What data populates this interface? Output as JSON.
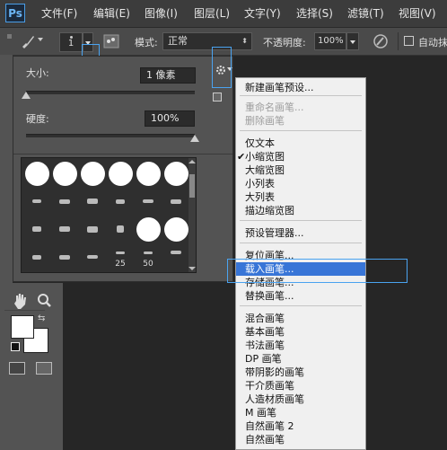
{
  "app": {
    "logo": "Ps"
  },
  "menubar": {
    "items": [
      "文件(F)",
      "编辑(E)",
      "图像(I)",
      "图层(L)",
      "文字(Y)",
      "选择(S)",
      "滤镜(T)",
      "视图(V)"
    ]
  },
  "options_bar": {
    "brush_size": "1",
    "mode_label": "模式:",
    "mode_value": "正常",
    "opacity_label": "不透明度:",
    "opacity_value": "100%",
    "auto_label": "自动抹"
  },
  "brush_panel": {
    "size_label": "大小:",
    "size_value": "1 像素",
    "size_slider": 0,
    "hardness_label": "硬度:",
    "hardness_value": "100%",
    "hardness_slider": 1,
    "preset_numbers": [
      "25",
      "50"
    ]
  },
  "context_menu": {
    "items": [
      {
        "label": "新建画笔预设...",
        "state": "normal"
      },
      {
        "label": "重命名画笔...",
        "state": "disabled"
      },
      {
        "label": "删除画笔",
        "state": "disabled"
      },
      {
        "label": "仅文本",
        "state": "normal"
      },
      {
        "label": "小缩览图",
        "state": "checked"
      },
      {
        "label": "大缩览图",
        "state": "normal"
      },
      {
        "label": "小列表",
        "state": "normal"
      },
      {
        "label": "大列表",
        "state": "normal"
      },
      {
        "label": "描边缩览图",
        "state": "normal"
      },
      {
        "label": "预设管理器...",
        "state": "normal"
      },
      {
        "label": "复位画笔...",
        "state": "normal"
      },
      {
        "label": "载入画笔...",
        "state": "selected"
      },
      {
        "label": "存储画笔...",
        "state": "normal"
      },
      {
        "label": "替换画笔...",
        "state": "normal"
      },
      {
        "label": "混合画笔",
        "state": "normal"
      },
      {
        "label": "基本画笔",
        "state": "normal"
      },
      {
        "label": "书法画笔",
        "state": "normal"
      },
      {
        "label": "DP 画笔",
        "state": "normal"
      },
      {
        "label": "带阴影的画笔",
        "state": "normal"
      },
      {
        "label": "干介质画笔",
        "state": "normal"
      },
      {
        "label": "人造材质画笔",
        "state": "normal"
      },
      {
        "label": "M 画笔",
        "state": "normal"
      },
      {
        "label": "自然画笔 2",
        "state": "normal"
      },
      {
        "label": "自然画笔",
        "state": "normal"
      }
    ],
    "check_mark": "✔"
  },
  "colors": {
    "menubar_bg": "#3c3c3c",
    "panel_bg": "#535353",
    "canvas_bg": "#262626",
    "menu_bg": "#f0f0f0",
    "selection": "#3875d7",
    "annotation_highlight": "#4aa3f0"
  }
}
